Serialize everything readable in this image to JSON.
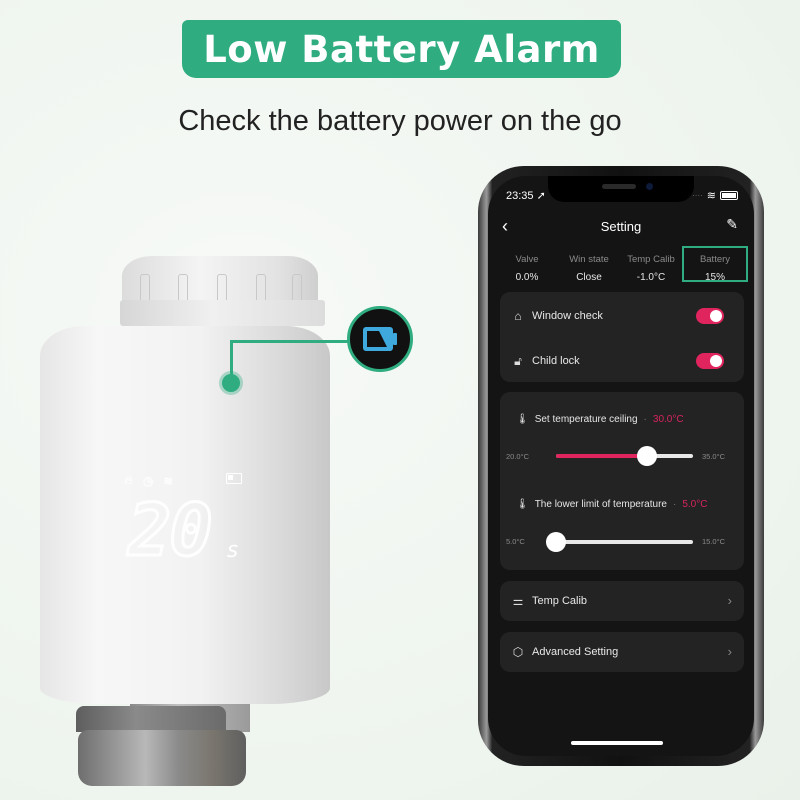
{
  "banner": {
    "title": "Low Battery Alarm"
  },
  "subtitle": "Check the battery power on the go",
  "colors": {
    "accent": "#2fac80",
    "toggle_on": "#e0245e",
    "value_red": "#d8245c"
  },
  "thermostat": {
    "display_value": "20",
    "display_suffix": "s",
    "lcd_icons": [
      "flame-icon",
      "clock-icon",
      "wifi-icon",
      "battery-low-icon"
    ],
    "callout_icon": "battery-low-icon"
  },
  "phone": {
    "status_bar": {
      "time": "23:35",
      "location_icon": "➚"
    },
    "nav": {
      "back": "‹",
      "title": "Setting",
      "edit": "✎"
    },
    "stats": [
      {
        "label": "Valve",
        "value": "0.0%"
      },
      {
        "label": "Win state",
        "value": "Close"
      },
      {
        "label": "Temp Calib",
        "value": "-1.0°C"
      },
      {
        "label": "Battery",
        "value": "15%",
        "highlighted": true
      }
    ],
    "toggles": [
      {
        "label": "Window check",
        "icon": "home-search-icon",
        "on": true
      },
      {
        "label": "Child lock",
        "icon": "unlock-icon",
        "on": true
      }
    ],
    "sliders": [
      {
        "label": "Set temperature ceiling",
        "value_text": "30.0°C",
        "min_text": "20.0°C",
        "max_text": "35.0°C",
        "min": 20,
        "max": 35,
        "value": 30
      },
      {
        "label": "The lower limit of temperature",
        "value_text": "5.0°C",
        "min_text": "5.0°C",
        "max_text": "15.0°C",
        "min": 5,
        "max": 15,
        "value": 5
      }
    ],
    "menu": [
      {
        "label": "Temp Calib",
        "icon": "sliders-icon"
      },
      {
        "label": "Advanced Setting",
        "icon": "hexagon-settings-icon"
      }
    ]
  }
}
